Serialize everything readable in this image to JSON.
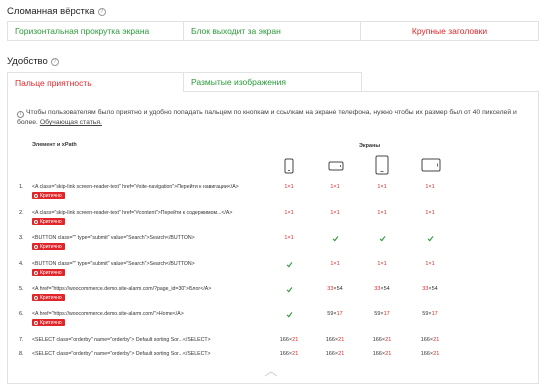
{
  "broken_layout": {
    "title": "Сломанная вёрстка",
    "tabs": [
      {
        "label": "Горизонтальная прокрутка экрана",
        "status": "green"
      },
      {
        "label": "Блок выходит за экран",
        "status": "green"
      },
      {
        "label": "Крупные заголовки",
        "status": "red"
      }
    ]
  },
  "convenience": {
    "title": "Удобство",
    "tabs": [
      {
        "label": "Пальце приятность",
        "status": "red"
      },
      {
        "label": "Размытые изображения",
        "status": "green"
      }
    ]
  },
  "info_text": "Чтобы пользователям было приятно и удобно попадать пальцем по кнопкам и ссылкам на экране телефона, нужно чтобы их размер был от 40 пикселей и более.",
  "info_link": "Обучающая статья.",
  "table": {
    "col_element": "Элемент и xPath",
    "col_screens": "Экраны",
    "badge_label": "Критично",
    "rows": [
      {
        "num": "1.",
        "code": "<A class=\"skip-link screen-reader-text\" href=\"#site-navigation\">Перейти к навигации</A>",
        "critical": true,
        "values": [
          {
            "t": "1×1",
            "w": true,
            "h": true
          },
          {
            "t": "1×1",
            "w": true,
            "h": true
          },
          {
            "t": "1×1",
            "w": true,
            "h": true
          },
          {
            "t": "1×1",
            "w": true,
            "h": true
          }
        ]
      },
      {
        "num": "2.",
        "code": "<A class=\"skip-link screen-reader-text\" href=\"#content\">Перейти к содержимом...</A>",
        "critical": true,
        "values": [
          {
            "t": "1×1",
            "w": true,
            "h": true
          },
          {
            "t": "1×1",
            "w": true,
            "h": true
          },
          {
            "t": "1×1",
            "w": true,
            "h": true
          },
          {
            "t": "1×1",
            "w": true,
            "h": true
          }
        ]
      },
      {
        "num": "3.",
        "code": "<BUTTON class=\"\" type=\"submit\" value=\"Search\">Search</BUTTON>",
        "critical": true,
        "values": [
          {
            "t": "1×1",
            "w": true,
            "h": true
          },
          {
            "check": true
          },
          {
            "check": true
          },
          {
            "check": true
          }
        ]
      },
      {
        "num": "4.",
        "code": "<BUTTON class=\"\" type=\"submit\" value=\"Search\">Search</BUTTON>",
        "critical": true,
        "values": [
          {
            "check": true
          },
          {
            "t": "1×1",
            "w": true,
            "h": true
          },
          {
            "t": "1×1",
            "w": true,
            "h": true
          },
          {
            "t": "1×1",
            "w": true,
            "h": true
          }
        ]
      },
      {
        "num": "5.",
        "code": "<A href=\"https://woocommerce.demo.site-alarm.com/?page_id=30\">Блог</A>",
        "critical": true,
        "values": [
          {
            "check": true
          },
          {
            "w_t": "33",
            "h_t": "54",
            "w": true,
            "h": false
          },
          {
            "w_t": "33",
            "h_t": "54",
            "w": true,
            "h": false
          },
          {
            "w_t": "33",
            "h_t": "54",
            "w": true,
            "h": false
          }
        ]
      },
      {
        "num": "6.",
        "code": "<A href=\"https://woocommerce.demo.site-alarm.com/\">Home</A>",
        "critical": true,
        "values": [
          {
            "check": true
          },
          {
            "w_t": "59",
            "h_t": "17",
            "w": false,
            "h": true
          },
          {
            "w_t": "59",
            "h_t": "17",
            "w": false,
            "h": true
          },
          {
            "w_t": "59",
            "h_t": "17",
            "w": false,
            "h": true
          }
        ]
      },
      {
        "num": "7.",
        "code": "<SELECT class=\"orderby\" name=\"orderby\"> Default sorting Sor...</SELECT>",
        "critical": false,
        "values": [
          {
            "w_t": "166",
            "h_t": "21",
            "w": false,
            "h": true
          },
          {
            "w_t": "166",
            "h_t": "21",
            "w": false,
            "h": true
          },
          {
            "w_t": "166",
            "h_t": "21",
            "w": false,
            "h": true
          },
          {
            "w_t": "166",
            "h_t": "21",
            "w": false,
            "h": true
          }
        ]
      },
      {
        "num": "8.",
        "code": "<SELECT class=\"orderby\" name=\"orderby\"> Default sorting Sor...</SELECT>",
        "critical": false,
        "values": [
          {
            "w_t": "166",
            "h_t": "21",
            "w": false,
            "h": true
          },
          {
            "w_t": "166",
            "h_t": "21",
            "w": false,
            "h": true
          },
          {
            "w_t": "166",
            "h_t": "21",
            "w": false,
            "h": true
          },
          {
            "w_t": "166",
            "h_t": "21",
            "w": false,
            "h": true
          }
        ]
      }
    ]
  },
  "colors": {
    "green": "#2a9a3a",
    "red": "#e0262a",
    "border": "#e2e2e2"
  },
  "icons": [
    "help-icon",
    "info-icon",
    "phone-portrait-icon",
    "phone-landscape-icon",
    "tablet-portrait-icon",
    "tablet-landscape-icon",
    "check-icon",
    "alert-circle-icon",
    "chevron-up-icon"
  ]
}
